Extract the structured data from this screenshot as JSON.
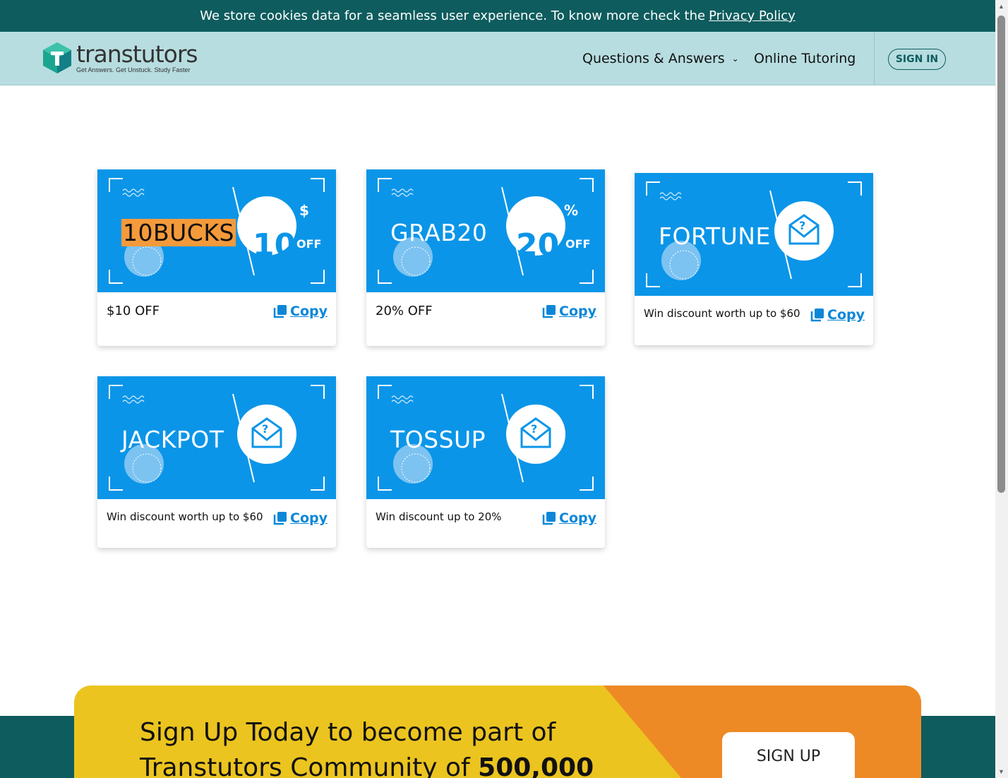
{
  "cookie_bar": {
    "message": "We store cookies data for a seamless user experience. To know more check the",
    "link": "Privacy Policy"
  },
  "header": {
    "logo_name": "transtutors",
    "logo_tagline": "Get Answers. Get Unstuck. Study Faster",
    "nav": {
      "qa": "Questions & Answers",
      "tutoring": "Online Tutoring"
    },
    "signin": "SIGN IN"
  },
  "coupons": [
    {
      "code": "10BUCKS",
      "badge_value": "10",
      "badge_unit": "$",
      "badge_off": "OFF",
      "description": "$10 OFF",
      "copy": "Copy"
    },
    {
      "code": "GRAB20",
      "badge_value": "20",
      "badge_unit": "%",
      "badge_off": "OFF",
      "description": "20% OFF",
      "copy": "Copy"
    },
    {
      "code": "FORTUNE",
      "description": "Win discount worth up to $60",
      "copy": "Copy"
    },
    {
      "code": "JACKPOT",
      "description": "Win discount worth up to $60",
      "copy": "Copy"
    },
    {
      "code": "TOSSUP",
      "description": "Win discount up to 20%",
      "copy": "Copy"
    }
  ],
  "signup": {
    "line1": "Sign Up Today to become part of",
    "line2_prefix": "Transtutors Community of",
    "line2_number": "500,000",
    "button": "SIGN UP"
  },
  "colors": {
    "brand_teal": "#0e5c5e",
    "header_bg": "#b7dde0",
    "coupon_blue": "#0b95e8",
    "copy_blue": "#0b87d8",
    "highlight_orange": "#f49a3b",
    "signup_yellow": "#ebc41f",
    "signup_orange": "#ee8a25"
  }
}
